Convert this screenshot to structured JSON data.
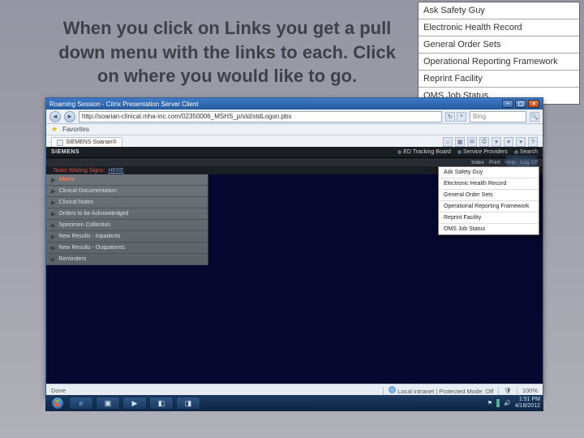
{
  "headline": "When you click on Links you get a pull down menu with the links to each. Click on where you would like to go.",
  "callout": {
    "items": [
      "Ask Safety Guy",
      "Electronic Health Record",
      "General Order Sets",
      "Operational Reporting Framework",
      "Reprint Facility",
      "OMS Job Status"
    ]
  },
  "window": {
    "title": "Roaming Session - Citrix Presentation Server Client",
    "address": "http://soarian-clinical.mha-inc.com/02350006_MSHS_p/std/stdLogon.pbs",
    "search_placeholder": "Bing",
    "favorites_label": "Favorites",
    "tab_label": "SIEMENS Soarian®",
    "toolbox": [
      "Home",
      "Page",
      "Safety",
      "Tools"
    ],
    "status_left": "Done",
    "status_zone": "Local intranet | Protected Mode: Off",
    "status_zoom": "100%"
  },
  "app": {
    "brand": "SIEMENS",
    "top_right": [
      "ED Tracking Board",
      "Service Providers",
      "Search"
    ],
    "sub_right": [
      "Index",
      "Print",
      "Help",
      "Log Off"
    ],
    "redbar": "Tasks Waiting Signs:",
    "redbar_link": "HERE",
    "leftpanel": [
      "Alerts",
      "Clinical Documentation",
      "Clinical Notes",
      "Orders to be Acknowledged",
      "Specimen Collection",
      "New Results - Inpatients",
      "New Results - Outpatients",
      "Reminders"
    ],
    "links_dd": [
      "Ask Safety Guy",
      "Electronic Health Record",
      "General Order Sets",
      "Operational Reporting Framework",
      "Reprint Facility",
      "OMS Job Status"
    ]
  },
  "taskbar": {
    "time": "1:51 PM",
    "date": "4/18/2012"
  }
}
